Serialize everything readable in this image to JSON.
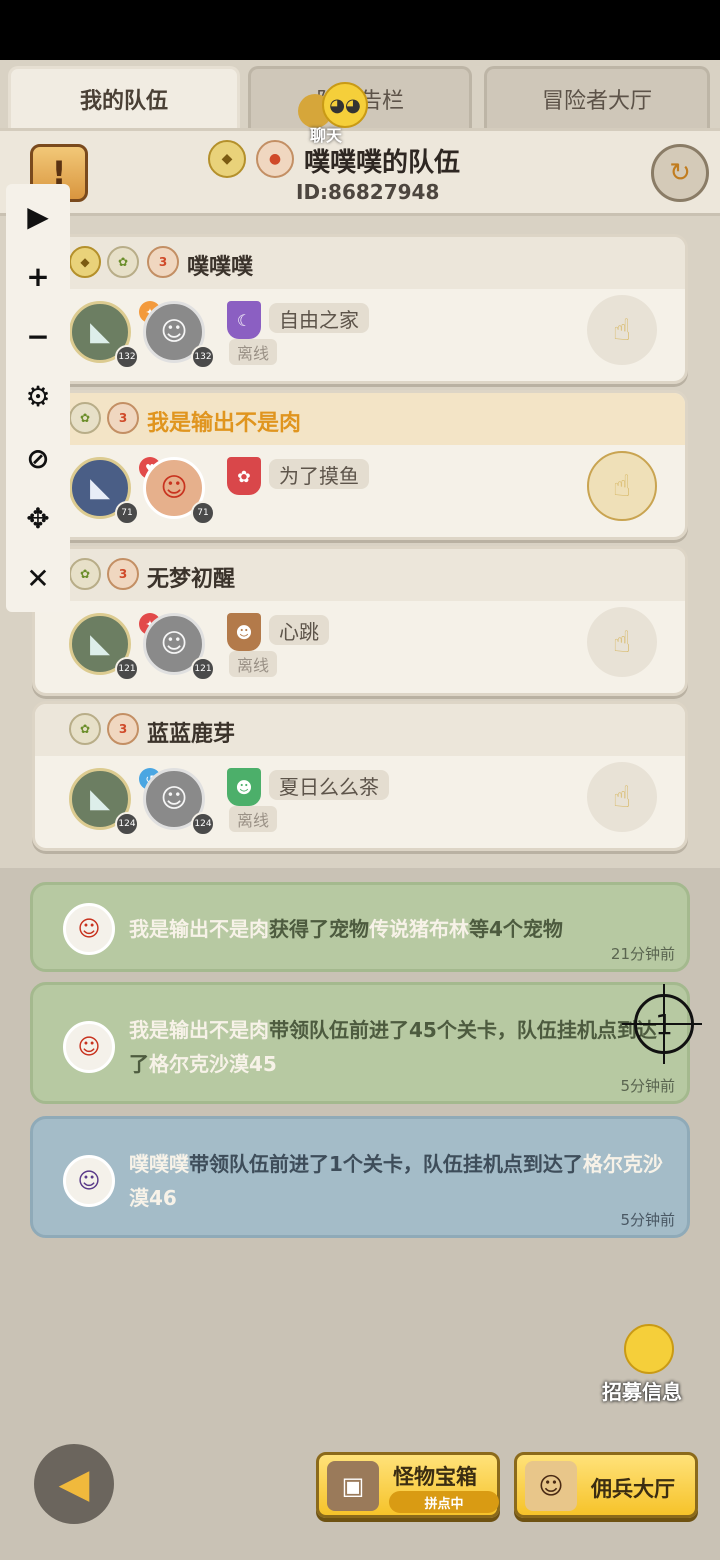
{
  "tabs": [
    {
      "label": "我的队伍"
    },
    {
      "label": "队伍告栏"
    },
    {
      "label": "冒险者大厅"
    }
  ],
  "chat_bubble": {
    "label": "聊天"
  },
  "header": {
    "team_name": "噗噗噗的队伍",
    "team_id": "ID:86827948"
  },
  "members": [
    {
      "name": "噗噗噗",
      "pet_level": "132",
      "hero_level": "132",
      "guild": "自由之家",
      "status": "离线",
      "highlight": false
    },
    {
      "name": "我是输出不是肉",
      "pet_level": "71",
      "hero_level": "71",
      "guild": "为了摸鱼",
      "status": "",
      "highlight": true
    },
    {
      "name": "无梦初醒",
      "pet_level": "121",
      "hero_level": "121",
      "guild": "心跳",
      "status": "离线",
      "highlight": false
    },
    {
      "name": "蓝蓝鹿芽",
      "pet_level": "124",
      "hero_level": "124",
      "guild": "夏日么么茶",
      "status": "离线",
      "highlight": false
    }
  ],
  "feed": [
    {
      "p1": "我是输出不是肉",
      "p2": "获得了宠物",
      "p3": "传说猪布林",
      "p4": "等4个宠物",
      "time": "21分钟前"
    },
    {
      "p1": "我是输出不是肉",
      "p2": "带领队伍前进了45个关卡，队伍挂机点到达了",
      "p3": "格尔克沙漠45",
      "p4": "",
      "time": "5分钟前"
    },
    {
      "p1": "噗噗噗",
      "p2": "带领队伍前进了1个关卡，队伍挂机点到达了",
      "p3": "格尔克沙漠46",
      "p4": "",
      "time": "5分钟前"
    }
  ],
  "crosshair": {
    "label": "1"
  },
  "recruit": {
    "label": "招募信息"
  },
  "bottom": {
    "chest_label": "怪物宝箱",
    "chest_sub": "拼点中",
    "hall_label": "佣兵大厅"
  },
  "toolbar_icons": [
    "play-icon",
    "zoom-in-icon",
    "zoom-out-icon",
    "gear-icon",
    "eye-off-icon",
    "move-icon",
    "close-icon"
  ]
}
